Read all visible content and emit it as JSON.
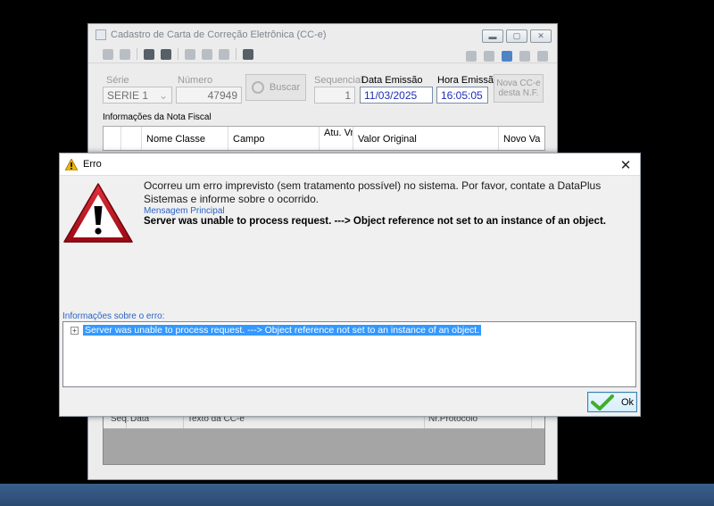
{
  "main_window": {
    "title": "Cadastro de Carta de Correção Eletrônica (CC-e)",
    "form": {
      "serie_label": "Série",
      "serie_value": "SERIE 1",
      "numero_label": "Número",
      "numero_value": "47949",
      "buscar_label": "Buscar",
      "sequencial_label": "Sequencial",
      "sequencial_value": "1",
      "data_emissao_label": "Data Emissão",
      "data_emissao_value": "11/03/2025",
      "hora_emissao_label": "Hora Emissão",
      "hora_emissao_value": "16:05:05",
      "nova_cce_label": "Nova CC-e desta N.F."
    },
    "nota_fiscal_section": "Informações da Nota Fiscal",
    "grid_columns": [
      "Nome Classe",
      "Campo",
      "Atu. Vr. NF.",
      "Valor Original",
      "Novo Va"
    ],
    "lower_columns": [
      "Seq.",
      "Data",
      "Texto da CC-e",
      "Nr.Protocolo"
    ]
  },
  "dialog": {
    "title": "Erro",
    "message": "Ocorreu um erro imprevisto (sem tratamento possível) no sistema. Por favor, contate a DataPlus Sistemas e informe sobre o ocorrido.",
    "main_message_label": "Mensagem Principal",
    "main_message": "Server was unable to process request. ---> Object reference not set to an instance of an object.",
    "info_label": "Informações sobre o erro:",
    "tree_item": "Server was unable to process request. ---> Object reference not set to an instance of an object.",
    "ok_label": "Ok",
    "close_glyph": "✕"
  },
  "colors": {
    "link_blue": "#2b63c7",
    "selection": "#3399ff",
    "warning_red": "#c8102e",
    "ok_check": "#3fae2a"
  }
}
